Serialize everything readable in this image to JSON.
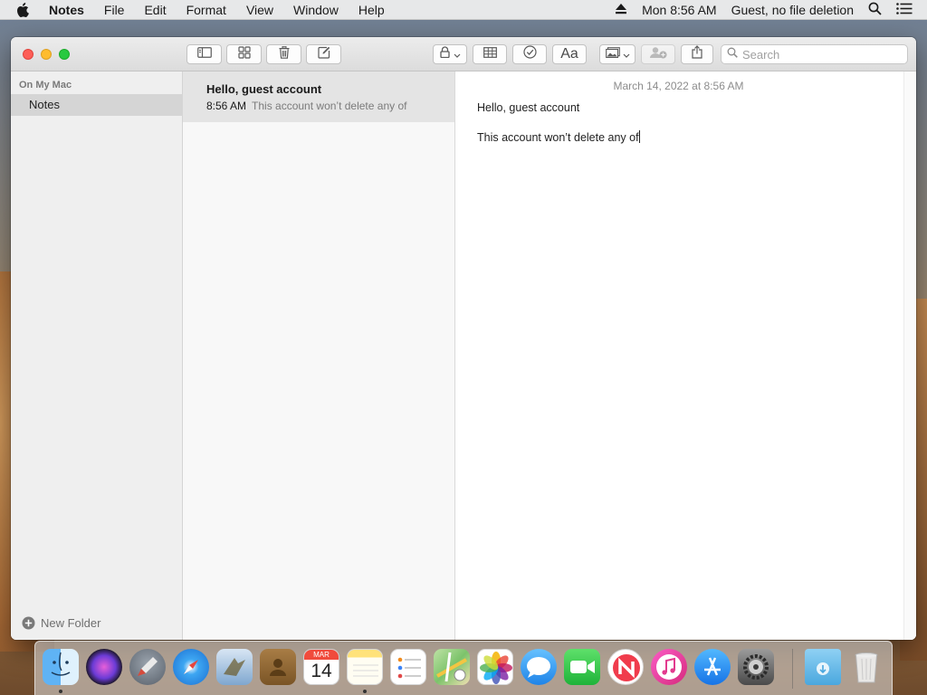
{
  "menubar": {
    "app_name": "Notes",
    "menus": [
      "File",
      "Edit",
      "Format",
      "View",
      "Window",
      "Help"
    ],
    "clock": "Mon 8:56 AM",
    "user": "Guest, no file deletion"
  },
  "window": {
    "search_placeholder": "Search",
    "format_label": "Aa"
  },
  "sidebar": {
    "section": "On My Mac",
    "folders": [
      "Notes"
    ],
    "new_folder_label": "New Folder"
  },
  "notes": [
    {
      "title": "Hello, guest account",
      "time": "8:56 AM",
      "preview": "This account won’t delete any of"
    }
  ],
  "editor": {
    "date": "March 14, 2022 at 8:56 AM",
    "line1": "Hello, guest account",
    "line2": "This account won’t delete any of"
  },
  "dock": {
    "calendar_month": "MAR",
    "calendar_day": "14"
  },
  "colors": {
    "close": "#fd5e57",
    "minimize": "#febc2e",
    "zoom": "#28c940",
    "selection": "#d5d5d5"
  }
}
